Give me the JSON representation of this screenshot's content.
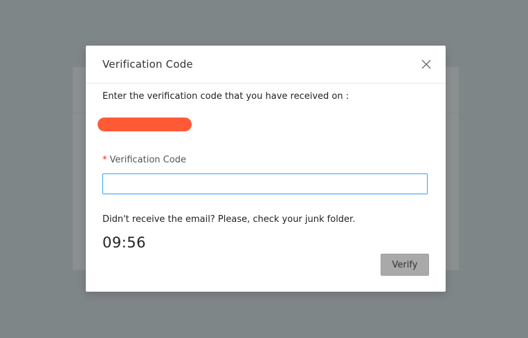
{
  "modal": {
    "title": "Verification Code",
    "intro": "Enter the verification code that you have received on :",
    "redaction_color": "#ff5a36",
    "field": {
      "required_mark": "*",
      "label": "Verification Code",
      "value": "",
      "placeholder": ""
    },
    "help_text": "Didn't receive the email? Please, check your junk folder.",
    "timer": "09:56",
    "verify_label": "Verify"
  },
  "icons": {
    "close": "close-icon"
  },
  "colors": {
    "overlay": "#7f8688",
    "accent_focus": "#40a9ff",
    "required": "#e0282e",
    "disabled_button": "#a9a9a9"
  }
}
